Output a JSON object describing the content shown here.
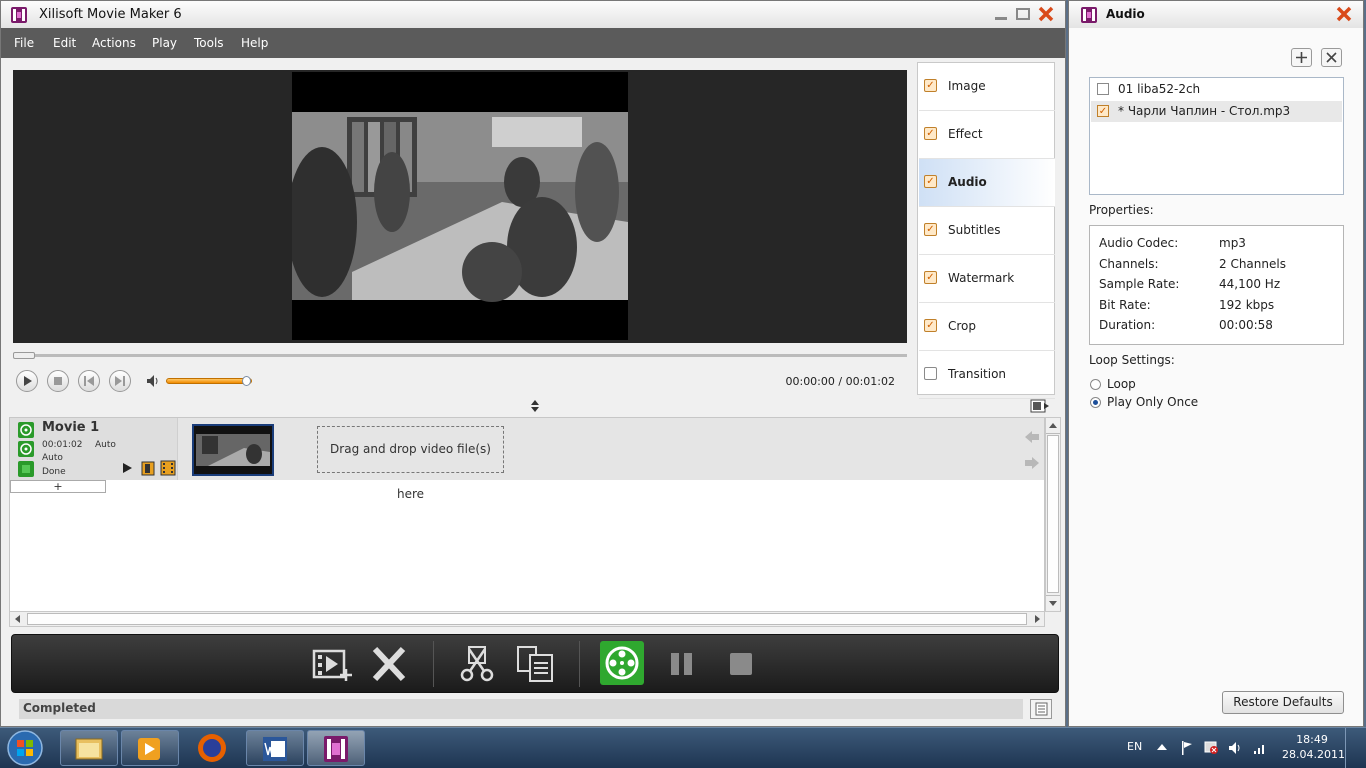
{
  "main_window": {
    "title": "Xilisoft Movie Maker 6",
    "menu": [
      "File",
      "Edit",
      "Actions",
      "Play",
      "Tools",
      "Help"
    ],
    "player": {
      "timecode": "00:00:00 / 00:01:02",
      "volume_level": 0.95,
      "seek_position": 0.0
    },
    "tabs": [
      {
        "label": "Image",
        "checked": true,
        "active": false
      },
      {
        "label": "Effect",
        "checked": true,
        "active": false
      },
      {
        "label": "Audio",
        "checked": true,
        "active": true
      },
      {
        "label": "Subtitles",
        "checked": true,
        "active": false
      },
      {
        "label": "Watermark",
        "checked": true,
        "active": false
      },
      {
        "label": "Crop",
        "checked": true,
        "active": false
      },
      {
        "label": "Transition",
        "checked": false,
        "active": false
      }
    ],
    "movie": {
      "name": "Movie 1",
      "duration": "00:01:02",
      "mode": "Auto",
      "format": "Auto",
      "status": "Done",
      "add_symbol": "+"
    },
    "dropzone_text": "Drag and drop video file(s) here",
    "status_text": "Completed"
  },
  "audio_window": {
    "title": "Audio",
    "files": [
      {
        "label": "01 liba52-2ch",
        "checked": false
      },
      {
        "label": "* Чарли Чаплин - Стол.mp3",
        "checked": true
      }
    ],
    "properties_label": "Properties:",
    "properties": [
      {
        "key": "Audio Codec:",
        "value": "mp3"
      },
      {
        "key": "Channels:",
        "value": "2 Channels"
      },
      {
        "key": "Sample Rate:",
        "value": "44,100 Hz"
      },
      {
        "key": "Bit Rate:",
        "value": "192 kbps"
      },
      {
        "key": "Duration:",
        "value": "00:00:58"
      }
    ],
    "loop_label": "Loop Settings:",
    "loop_options": [
      {
        "label": "Loop",
        "selected": false
      },
      {
        "label": "Play Only Once",
        "selected": true
      }
    ],
    "restore_label": "Restore Defaults"
  },
  "taskbar": {
    "language": "EN",
    "time": "18:49",
    "date": "28.04.2011"
  },
  "colors": {
    "accent": "#f08a00",
    "menubar": "#5b5b5b",
    "toolbar": "#1b1b1b",
    "active_tab": "#cfe0f5",
    "encode_green": "#2fa82f"
  }
}
